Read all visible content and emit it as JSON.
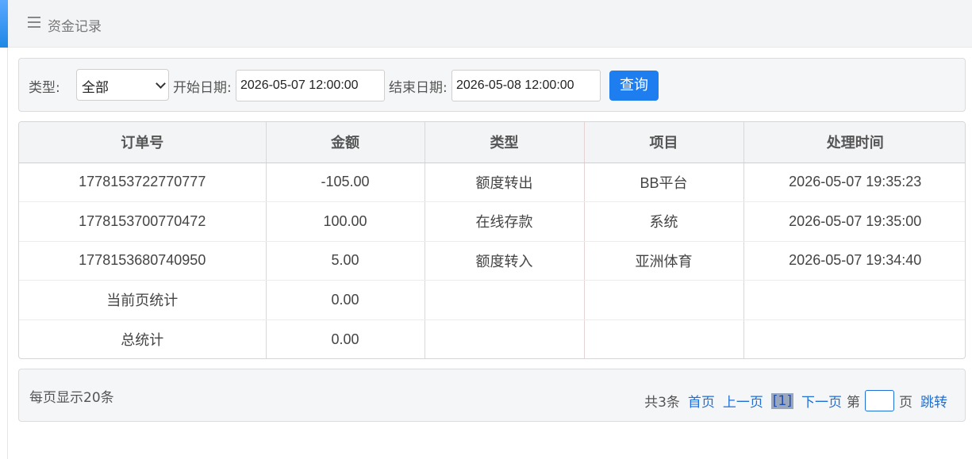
{
  "header": {
    "title": "资金记录"
  },
  "filter": {
    "type_label": "类型:",
    "type_selected": "全部",
    "start_label": "开始日期:",
    "start_value": "2026-05-07 12:00:00",
    "end_label": "结束日期:",
    "end_value": "2026-05-08 12:00:00",
    "query_label": "查询"
  },
  "table": {
    "columns": [
      "订单号",
      "金额",
      "类型",
      "项目",
      "处理时间"
    ],
    "rows": [
      [
        "1778153722770777",
        "-105.00",
        "额度转出",
        "BB平台",
        "2026-05-07 19:35:23"
      ],
      [
        "1778153700770472",
        "100.00",
        "在线存款",
        "系统",
        "2026-05-07 19:35:00"
      ],
      [
        "1778153680740950",
        "5.00",
        "额度转入",
        "亚洲体育",
        "2026-05-07 19:34:40"
      ],
      [
        "当前页统计",
        "0.00",
        "",
        "",
        ""
      ],
      [
        "总统计",
        "0.00",
        "",
        "",
        ""
      ]
    ]
  },
  "pager": {
    "per_page": "每页显示20条",
    "total": "共3条",
    "first": "首页",
    "prev": "上一页",
    "current": "[1]",
    "next": "下一页",
    "page_prefix": "第",
    "page_suffix": "页",
    "jump": "跳转"
  }
}
